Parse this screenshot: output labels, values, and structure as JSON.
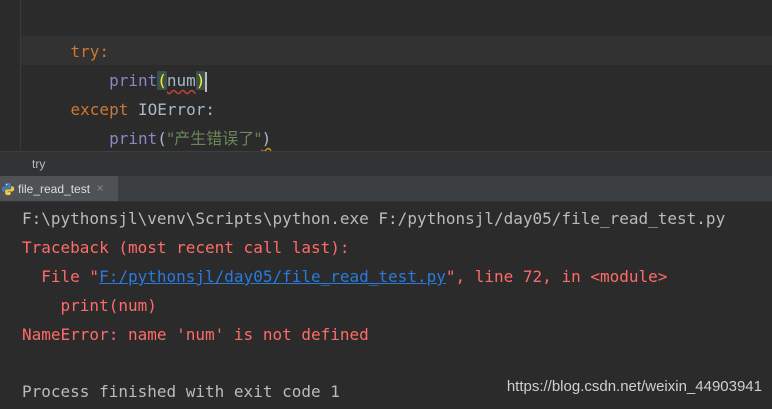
{
  "editor": {
    "line1": {
      "keyword": "try:"
    },
    "line2": {
      "func": "print",
      "open": "(",
      "arg": "num",
      "close": ")"
    },
    "line3": {
      "keyword": "except",
      "exception": "IOError",
      "colon": ":"
    },
    "line4": {
      "func": "print",
      "open": "(",
      "string": "\"产生错误了\"",
      "close": ")"
    }
  },
  "breadcrumb": {
    "label": "try"
  },
  "run_tab": {
    "label": "file_read_test",
    "icon": "python-icon",
    "close": "×"
  },
  "console": {
    "command": "F:\\pythonsjl\\venv\\Scripts\\python.exe F:/pythonsjl/day05/file_read_test.py",
    "traceback_header": "Traceback (most recent call last):",
    "file_prefix": "  File \"",
    "file_link": "F:/pythonsjl/day05/file_read_test.py",
    "file_suffix": "\", line 72, in <module>",
    "code_line": "    print(num)",
    "error": "NameError: name 'num' is not defined",
    "exit": "Process finished with exit code 1"
  },
  "watermark": "https://blog.csdn.net/weixin_44903941",
  "colors": {
    "background": "#2b2b2b",
    "keyword": "#cc7832",
    "builtin": "#8888c6",
    "string": "#6a8759",
    "error_text": "#ff6b68",
    "link": "#287bde"
  }
}
